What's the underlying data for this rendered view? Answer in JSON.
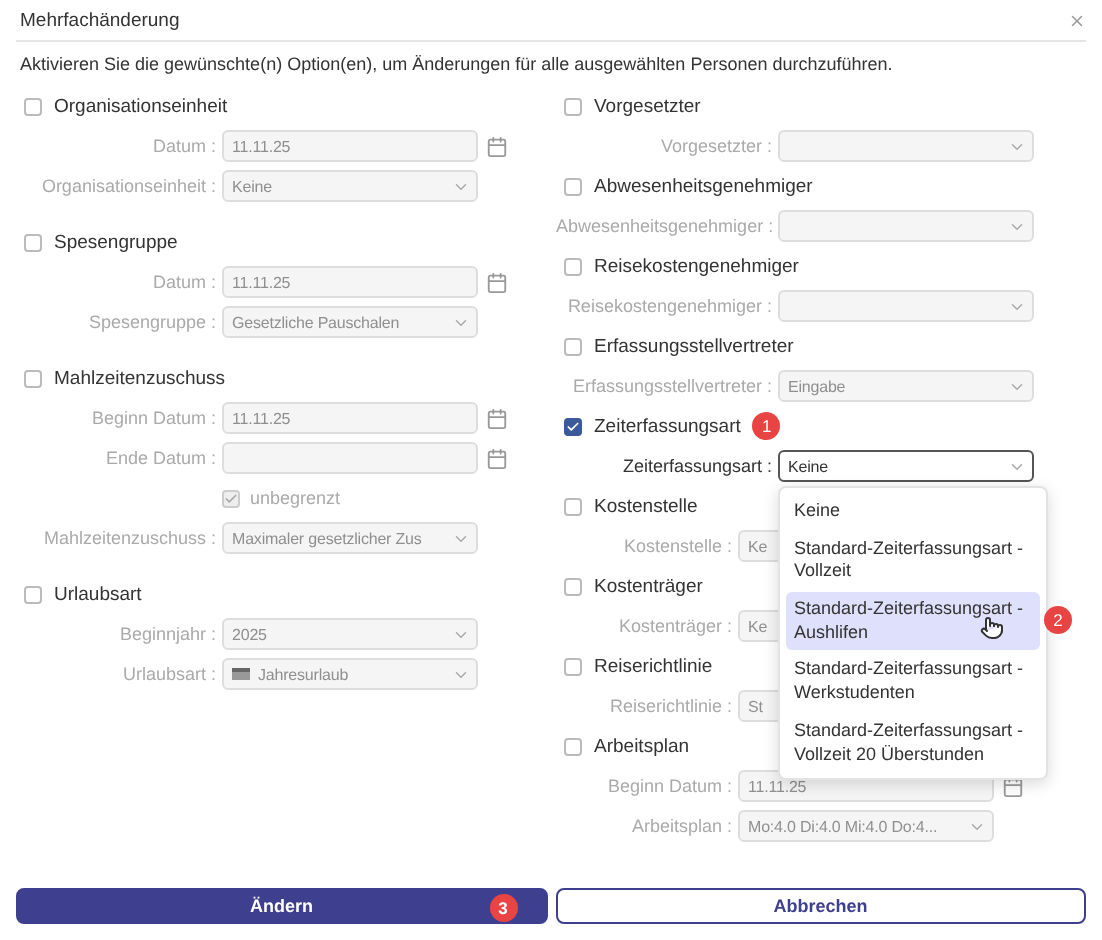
{
  "dialog": {
    "title": "Mehrfachänderung",
    "intro": "Aktivieren Sie die gewünschte(n) Option(en), um Änderungen für alle ausgewählten Personen durchzuführen.",
    "columns": [
      {
        "sections": [
          {
            "title": "Organisationseinheit",
            "checked": false,
            "fields": [
              {
                "kind": "date",
                "label": "Datum :",
                "value": "11.11.25"
              },
              {
                "kind": "select",
                "label": "Organisationseinheit :",
                "value": "Keine"
              }
            ]
          },
          {
            "title": "Spesengruppe",
            "checked": false,
            "fields": [
              {
                "kind": "date",
                "label": "Datum :",
                "value": "11.11.25"
              },
              {
                "kind": "select",
                "label": "Spesengruppe :",
                "value": "Gesetzliche Pauschalen"
              }
            ]
          },
          {
            "title": "Mahlzeitenzuschuss",
            "checked": false,
            "fields": [
              {
                "kind": "date",
                "label": "Beginn Datum :",
                "value": "11.11.25"
              },
              {
                "kind": "date",
                "label": "Ende Datum :"
              },
              {
                "kind": "checkbox",
                "label": "unbegrenzt",
                "checked": true
              },
              {
                "kind": "select",
                "label": "Mahlzeitenzuschuss :",
                "value": "Maximaler gesetzlicher Zus"
              }
            ]
          },
          {
            "title": "Urlaubsart",
            "checked": false,
            "fields": [
              {
                "kind": "select",
                "label": "Beginnjahr :",
                "value": "2025"
              },
              {
                "kind": "flag-select",
                "label": "Urlaubsart :",
                "value": "Jahresurlaub"
              }
            ]
          }
        ]
      },
      {
        "sections": [
          {
            "title": "Vorgesetzter",
            "checked": false,
            "fields": [
              {
                "kind": "select",
                "label": "Vorgesetzter :"
              }
            ]
          },
          {
            "title": "Abwesenheitsgenehmiger",
            "checked": false,
            "fields": [
              {
                "kind": "select",
                "label": "Abwesenheitsgenehmiger :"
              }
            ]
          },
          {
            "title": "Reisekostengenehmiger",
            "checked": false,
            "fields": [
              {
                "kind": "select",
                "label": "Reisekostengenehmiger :"
              }
            ]
          },
          {
            "title": "Erfassungsstellvertreter",
            "checked": false,
            "fields": [
              {
                "kind": "select",
                "label": "Erfassungsstellvertreter :",
                "value": "Eingabe"
              }
            ]
          },
          {
            "title": "Zeiterfassungsart",
            "checked": true,
            "badge": "1",
            "fields": [
              {
                "kind": "select",
                "label": "Zeiterfassungsart :",
                "value": "Keine",
                "open": true,
                "options": [
                  {
                    "label": "Keine",
                    "highlighted": false
                  },
                  {
                    "label": "Standard-Zeiterfassungsart - Vollzeit",
                    "highlighted": false
                  },
                  {
                    "label": "Standard-Zeiterfassungsart - Aushlifen",
                    "highlighted": true,
                    "badge": "2"
                  },
                  {
                    "label": "Standard-Zeiterfassungsart - Werkstudenten",
                    "highlighted": false
                  },
                  {
                    "label": "Standard-Zeiterfassungsart - Vollzeit 20 Überstunden",
                    "highlighted": false
                  }
                ]
              }
            ]
          },
          {
            "title": "Kostenstelle",
            "checked": false,
            "fields": [
              {
                "kind": "select",
                "label": "Kostenstelle :",
                "value": "Ke"
              }
            ]
          },
          {
            "title": "Kostenträger",
            "checked": false,
            "fields": [
              {
                "kind": "select",
                "label": "Kostenträger :",
                "value": "Ke"
              }
            ]
          },
          {
            "title": "Reiserichtlinie",
            "checked": false,
            "fields": [
              {
                "kind": "select",
                "label": "Reiserichtlinie :",
                "value": "St"
              }
            ]
          },
          {
            "title": "Arbeitsplan",
            "checked": false,
            "fields": [
              {
                "kind": "date",
                "label": "Beginn Datum :",
                "value": "11.11.25"
              },
              {
                "kind": "select",
                "label": "Arbeitsplan :",
                "value": "Mo:4.0 Di:4.0 Mi:4.0 Do:4..."
              }
            ]
          }
        ]
      }
    ],
    "buttons": [
      {
        "label": "Ändern",
        "kind": "primary",
        "badge": "3"
      },
      {
        "label": "Abbrechen",
        "kind": "secondary"
      }
    ]
  }
}
